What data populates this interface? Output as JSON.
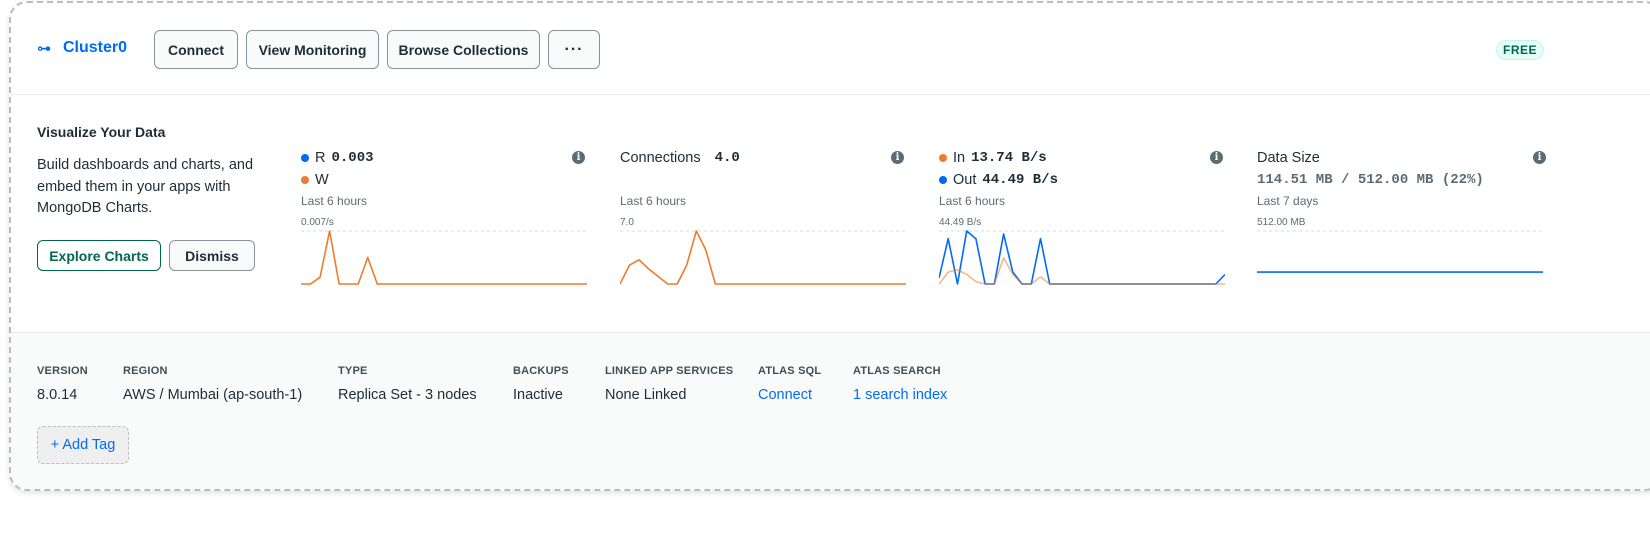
{
  "header": {
    "cluster_name": "Cluster0",
    "buttons": {
      "connect": "Connect",
      "view_monitoring": "View Monitoring",
      "browse_collections": "Browse Collections",
      "more": "···"
    },
    "tier_badge": "FREE"
  },
  "visualize": {
    "title": "Visualize Your Data",
    "description": "Build dashboards and charts, and embed them in your apps with MongoDB Charts.",
    "explore_label": "Explore Charts",
    "dismiss_label": "Dismiss"
  },
  "metrics": [
    {
      "id": "ops",
      "line1_label": "R",
      "line1_value": "0.003",
      "line2_label": "W",
      "period": "Last 6 hours",
      "axis_max": "0.007/s"
    },
    {
      "id": "connections",
      "label": "Connections",
      "value": "4.0",
      "period": "Last 6 hours",
      "axis_max": "7.0"
    },
    {
      "id": "network",
      "line1_label": "In",
      "line1_value": "13.74 B/s",
      "line2_label": "Out",
      "line2_value": "44.49 B/s",
      "period": "Last 6 hours",
      "axis_max": "44.49 B/s"
    },
    {
      "id": "data_size",
      "label": "Data Size",
      "value": "114.51 MB / 512.00 MB (22%)",
      "period": "Last 7 days",
      "axis_max": "512.00 MB"
    }
  ],
  "colors": {
    "accent_blue": "#016bf8",
    "accent_orange": "#ed7c2e",
    "brand_green": "#00684a"
  },
  "chart_data": [
    {
      "type": "line",
      "title": "",
      "period": "Last 6 hours",
      "ylim": [
        0,
        0.007
      ],
      "series": [
        {
          "name": "W",
          "color": "#ed7c2e",
          "values": [
            0,
            0,
            0.0009,
            0.007,
            0,
            0,
            0,
            0.0035,
            0,
            0,
            0,
            0,
            0,
            0,
            0,
            0,
            0,
            0,
            0,
            0,
            0,
            0,
            0,
            0,
            0,
            0,
            0,
            0,
            0,
            0,
            0
          ]
        }
      ]
    },
    {
      "type": "line",
      "title": "",
      "period": "Last 6 hours",
      "ylim": [
        0,
        7.0
      ],
      "series": [
        {
          "name": "",
          "color": "#ed7c2e",
          "values": [
            0,
            2.5,
            3.2,
            2,
            1,
            0,
            0,
            2.5,
            7.0,
            4.5,
            0,
            0,
            0,
            0,
            0,
            0,
            0,
            0,
            0,
            0,
            0,
            0,
            0,
            0,
            0,
            0,
            0,
            0,
            0,
            0,
            0
          ]
        }
      ]
    },
    {
      "type": "line",
      "title": "",
      "period": "Last 6 hours",
      "ylim": [
        0,
        44.49
      ],
      "series": [
        {
          "name": "Out",
          "color": "#016bf8",
          "values": [
            5,
            38,
            0,
            44.49,
            38,
            0,
            0,
            42,
            10,
            0,
            0,
            38,
            0,
            0,
            0,
            0,
            0,
            0,
            0,
            0,
            0,
            0,
            0,
            0,
            0,
            0,
            0,
            0,
            0,
            0,
            0,
            8
          ]
        },
        {
          "name": "In",
          "color": "#ed7c2e",
          "values": [
            0,
            10,
            12,
            8,
            2,
            0,
            0,
            22,
            8,
            0,
            0,
            6,
            0,
            0,
            0,
            0,
            0,
            0,
            0,
            0,
            0,
            0,
            0,
            0,
            0,
            0,
            0,
            0,
            0,
            0,
            0,
            0
          ]
        }
      ]
    },
    {
      "type": "line",
      "title": "",
      "period": "Last 7 days",
      "ylim": [
        0,
        512
      ],
      "series": [
        {
          "name": "",
          "color": "#016bf8",
          "values": [
            114.51,
            114.51,
            114.51,
            114.51,
            114.51,
            114.51,
            114.51,
            114.51
          ]
        }
      ]
    }
  ],
  "footer": {
    "version": {
      "label": "VERSION",
      "value": "8.0.14"
    },
    "region": {
      "label": "REGION",
      "value": "AWS / Mumbai (ap-south-1)"
    },
    "type": {
      "label": "TYPE",
      "value": "Replica Set - 3 nodes"
    },
    "backups": {
      "label": "BACKUPS",
      "value": "Inactive"
    },
    "linked_apps": {
      "label": "LINKED APP SERVICES",
      "value": "None Linked"
    },
    "atlas_sql": {
      "label": "ATLAS SQL",
      "value": "Connect"
    },
    "atlas_search": {
      "label": "ATLAS SEARCH",
      "value": "1 search index"
    },
    "add_tag": "+ Add Tag"
  }
}
